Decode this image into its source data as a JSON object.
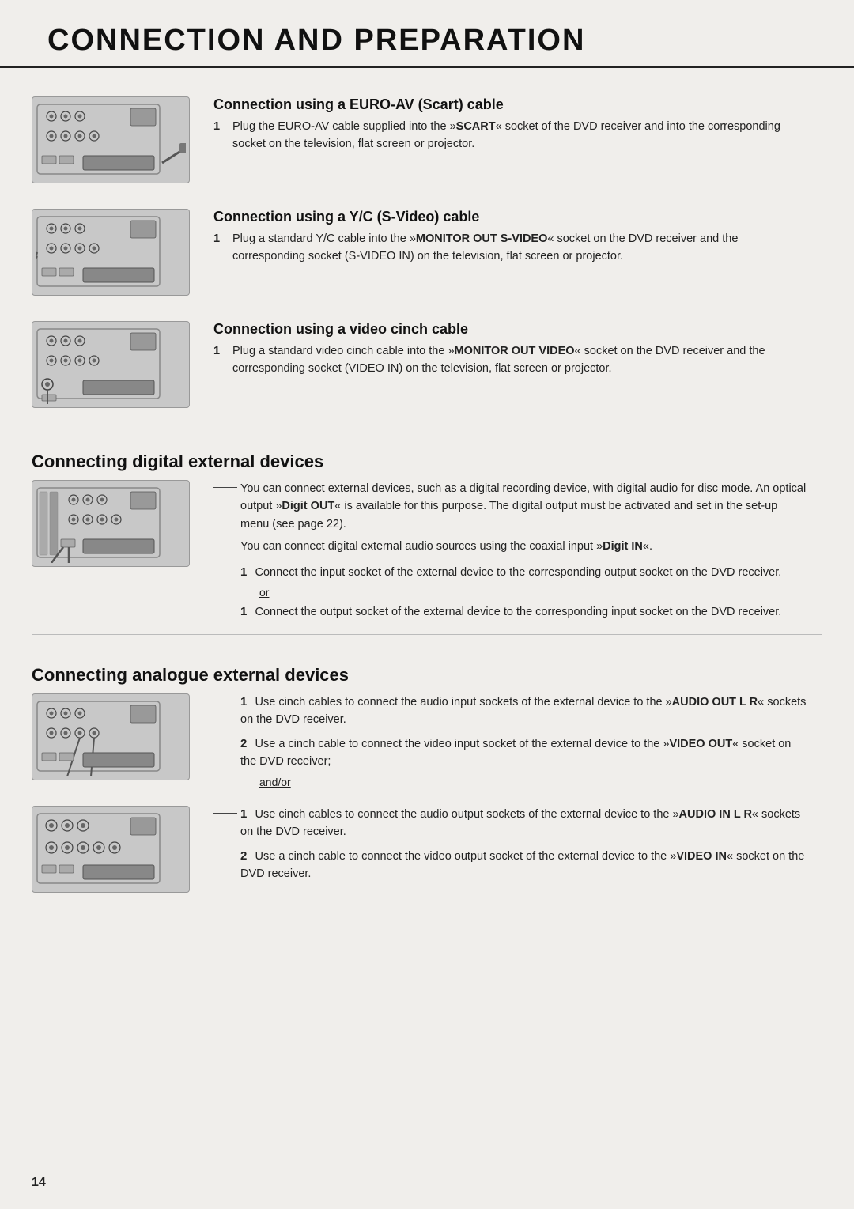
{
  "header": {
    "title": "CONNECTION AND PREPARATION"
  },
  "page_number": "14",
  "sections": [
    {
      "id": "euro-av",
      "title": "Connection using a EURO-AV (Scart) cable",
      "steps": [
        {
          "num": "1",
          "text": "Plug the EURO-AV cable supplied into the »SCART« socket of the DVD receiver and into the corresponding socket on the television, flat screen or projector.",
          "bold_parts": [
            "SCART"
          ]
        }
      ]
    },
    {
      "id": "yc-svideo",
      "title": "Connection using a Y/C (S-Video) cable",
      "steps": [
        {
          "num": "1",
          "text": "Plug a standard Y/C cable into the »MONITOR OUT S-VIDEO« socket on the DVD receiver and the corresponding socket (S-VIDEO IN) on the television, flat screen or projector.",
          "bold_parts": [
            "MONITOR OUT S-VIDEO"
          ]
        }
      ]
    },
    {
      "id": "video-cinch",
      "title": "Connection using a video cinch cable",
      "steps": [
        {
          "num": "1",
          "text": "Plug a standard video cinch cable into the »MONITOR OUT VIDEO« socket on the DVD receiver and the corresponding socket (VIDEO IN) on the television, flat screen or projector.",
          "bold_parts": [
            "MONITOR OUT VIDEO"
          ]
        }
      ]
    }
  ],
  "digital_section": {
    "title": "Connecting digital external devices",
    "intro_1": "You can connect external devices, such as a digital recording device, with digital audio for disc mode. An optical output »Digit OUT« is available for this purpose. The digital output must be activated and set in the set-up menu (see page 22).",
    "intro_2": "You can connect digital external audio sources using the coaxial input »Digit IN«.",
    "bold_in_intro1": [
      "Digit OUT"
    ],
    "bold_in_intro2": [
      "Digit IN"
    ],
    "steps": [
      {
        "num": "1",
        "text": "Connect the input socket of the external device to the corresponding output socket on the DVD receiver."
      }
    ],
    "or_label": "or",
    "steps2": [
      {
        "num": "1",
        "text": "Connect the output socket of the external device to the corresponding input socket on the DVD receiver."
      }
    ]
  },
  "analogue_section": {
    "title": "Connecting analogue external devices",
    "steps_group1": [
      {
        "num": "1",
        "text": "Use cinch cables to connect the audio input sockets of the external device to the »AUDIO OUT L R« sockets on the DVD receiver.",
        "bold_parts": [
          "AUDIO OUT L R"
        ]
      },
      {
        "num": "2",
        "text": "Use a cinch cable to connect the video input socket of the external device to the »VIDEO OUT« socket on the DVD receiver;",
        "bold_parts": [
          "VIDEO OUT"
        ]
      }
    ],
    "andor_label": "and/or",
    "steps_group2": [
      {
        "num": "1",
        "text": "Use cinch cables to connect the audio output sockets of the external device to the »AUDIO IN L R« sockets on the DVD receiver.",
        "bold_parts": [
          "AUDIO IN L R"
        ]
      },
      {
        "num": "2",
        "text": "Use a cinch cable to connect the video output socket of the external device to the »VIDEO IN« socket on the DVD receiver.",
        "bold_parts": [
          "VIDEO IN"
        ]
      }
    ]
  }
}
